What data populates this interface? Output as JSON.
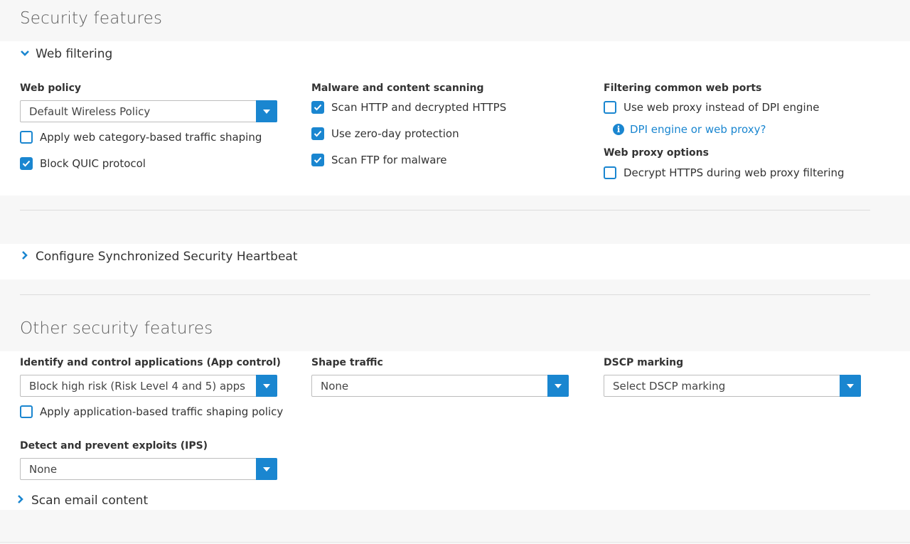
{
  "security": {
    "title": "Security features",
    "web_filtering": {
      "header": "Web filtering",
      "web_policy": {
        "label": "Web policy",
        "selected": "Default Wireless Policy",
        "apply_shaping": {
          "label": "Apply web category-based traffic shaping",
          "checked": false
        },
        "block_quic": {
          "label": "Block QUIC protocol",
          "checked": true
        }
      },
      "malware": {
        "label": "Malware and content scanning",
        "scan_http": {
          "label": "Scan HTTP and decrypted HTTPS",
          "checked": true
        },
        "zero_day": {
          "label": "Use zero-day protection",
          "checked": true
        },
        "scan_ftp": {
          "label": "Scan FTP for malware",
          "checked": true
        }
      },
      "ports": {
        "label": "Filtering common web ports",
        "use_proxy": {
          "label": "Use web proxy instead of DPI engine",
          "checked": false
        },
        "help_link": "DPI engine or web proxy?"
      },
      "proxy_options": {
        "label": "Web proxy options",
        "decrypt": {
          "label": "Decrypt HTTPS during web proxy filtering",
          "checked": false
        }
      }
    },
    "heartbeat": {
      "header": "Configure Synchronized Security Heartbeat"
    }
  },
  "other": {
    "title": "Other security features",
    "app_control": {
      "label": "Identify and control applications (App control)",
      "selected": "Block high risk (Risk Level 4 and 5) apps",
      "apply_shaping": {
        "label": "Apply application-based traffic shaping policy",
        "checked": false
      }
    },
    "shape_traffic": {
      "label": "Shape traffic",
      "selected": "None"
    },
    "dscp": {
      "label": "DSCP marking",
      "selected": "Select DSCP marking"
    },
    "ips": {
      "label": "Detect and prevent exploits (IPS)",
      "selected": "None"
    },
    "email": {
      "header": "Scan email content"
    }
  },
  "colors": {
    "accent": "#1a86d0",
    "panel": "#ffffff",
    "background": "#f7f7f7"
  },
  "icons": {
    "expanded": "chevron-down-icon",
    "collapsed": "chevron-right-icon",
    "dropdown": "caret-down-icon",
    "info": "info-icon",
    "check": "check-icon"
  }
}
